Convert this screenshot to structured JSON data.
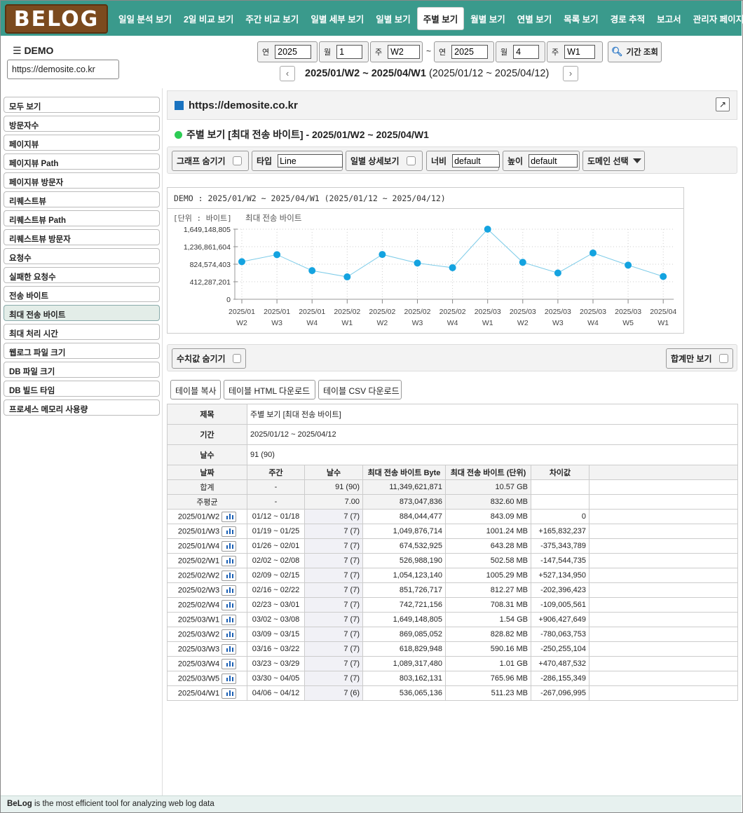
{
  "app": {
    "logo": "BELOG"
  },
  "nav": [
    "일일 분석 보기",
    "2일 비교 보기",
    "주간 비교 보기",
    "일별 세부 보기",
    "일별 보기",
    "주별 보기",
    "월별 보기",
    "연별 보기",
    "목록 보기",
    "경로 추적",
    "보고서",
    "관리자 페이지"
  ],
  "nav_active_index": 5,
  "header": {
    "menu_title": "☰ DEMO",
    "site_url": "https://demosite.co.kr"
  },
  "period": {
    "from_year_label": "연",
    "from_year": "2025",
    "from_month_label": "월",
    "from_month": "1",
    "from_week_label": "주",
    "from_week": "W2",
    "tilde": "~",
    "to_year_label": "연",
    "to_year": "2025",
    "to_month_label": "월",
    "to_month": "4",
    "to_week_label": "주",
    "to_week": "W1",
    "search_label": "기간 조회",
    "range_bold": "2025/01/W2 ~ 2025/04/W1",
    "range_dates": " (2025/01/12 ~ 2025/04/12)",
    "prev": "‹",
    "next": "›"
  },
  "sidebar": [
    "모두 보기",
    "방문자수",
    "페이지뷰",
    "페이지뷰 Path",
    "페이지뷰 방문자",
    "리퀘스트뷰",
    "리퀘스트뷰 Path",
    "리퀘스트뷰 방문자",
    "요청수",
    "실패한 요청수",
    "전송 바이트",
    "최대 전송 바이트",
    "최대 처리 시간",
    "웹로그 파일 크기",
    "DB 파일 크기",
    "DB 빌드 타임",
    "프로세스 메모리 사용량"
  ],
  "sidebar_active_index": 11,
  "main": {
    "site_title": "https://demosite.co.kr",
    "section_title": "주별 보기 [최대 전송 바이트] - 2025/01/W2 ~ 2025/04/W1",
    "toolbar": {
      "hide_graph": "그래프 숨기기",
      "type_label": "타입",
      "type_value": "Line",
      "daily_detail": "일별 상세보기",
      "width_label": "너비",
      "width_value": "default",
      "height_label": "높이",
      "height_value": "default",
      "domain_select": "도메인 선택"
    },
    "toolbar2": {
      "hide_values": "수치값 숨기기",
      "total_only": "합계만 보기"
    },
    "buttons": {
      "copy": "테이블 복사",
      "html": "테이블 HTML 다운로드",
      "csv": "테이블 CSV 다운로드"
    }
  },
  "chart_data": {
    "type": "line",
    "title": "DEMO : 2025/01/W2 ~ 2025/04/W1 (2025/01/12 ~ 2025/04/12)",
    "unit_label": "[단위 : 바이트]",
    "series_label": "최대 전송 바이트",
    "categories": [
      [
        "2025/01",
        "W2"
      ],
      [
        "2025/01",
        "W3"
      ],
      [
        "2025/01",
        "W4"
      ],
      [
        "2025/02",
        "W1"
      ],
      [
        "2025/02",
        "W2"
      ],
      [
        "2025/02",
        "W3"
      ],
      [
        "2025/02",
        "W4"
      ],
      [
        "2025/03",
        "W1"
      ],
      [
        "2025/03",
        "W2"
      ],
      [
        "2025/03",
        "W3"
      ],
      [
        "2025/03",
        "W4"
      ],
      [
        "2025/03",
        "W5"
      ],
      [
        "2025/04",
        "W1"
      ]
    ],
    "y_ticks": [
      "1,649,148,805",
      "1,236,861,604",
      "824,574,403",
      "412,287,201",
      "0"
    ],
    "ylim": [
      0,
      1649148805
    ],
    "series": [
      {
        "name": "최대 전송 바이트",
        "values": [
          884044477,
          1049876714,
          674532925,
          526988190,
          1054123140,
          851726717,
          742721156,
          1649148805,
          869085052,
          618829948,
          1089317480,
          803162131,
          536065136
        ],
        "color": "#14a3e0"
      }
    ],
    "grid": true
  },
  "table": {
    "info": [
      {
        "label": "제목",
        "value": "주별 보기 [최대 전송 바이트]"
      },
      {
        "label": "기간",
        "value": "2025/01/12 ~ 2025/04/12"
      },
      {
        "label": "날수",
        "value": "91 (90)"
      }
    ],
    "headers": [
      "날짜",
      "주간",
      "날수",
      "최대 전송 바이트 Byte",
      "최대 전송 바이트 (단위)",
      "차이값",
      ""
    ],
    "summary": [
      {
        "date": "합계",
        "week": "-",
        "days": "91 (90)",
        "bytes": "11,349,621,871",
        "unit": "10.57 GB",
        "diff": ""
      },
      {
        "date": "주평균",
        "week": "-",
        "days": "7.00",
        "bytes": "873,047,836",
        "unit": "832.60 MB",
        "diff": ""
      }
    ],
    "rows": [
      {
        "date": "2025/01/W2",
        "week": "01/12 ~ 01/18",
        "days": "7 (7)",
        "bytes": "884,044,477",
        "unit": "843.09 MB",
        "diff": "0"
      },
      {
        "date": "2025/01/W3",
        "week": "01/19 ~ 01/25",
        "days": "7 (7)",
        "bytes": "1,049,876,714",
        "unit": "1001.24 MB",
        "diff": "+165,832,237"
      },
      {
        "date": "2025/01/W4",
        "week": "01/26 ~ 02/01",
        "days": "7 (7)",
        "bytes": "674,532,925",
        "unit": "643.28 MB",
        "diff": "-375,343,789"
      },
      {
        "date": "2025/02/W1",
        "week": "02/02 ~ 02/08",
        "days": "7 (7)",
        "bytes": "526,988,190",
        "unit": "502.58 MB",
        "diff": "-147,544,735"
      },
      {
        "date": "2025/02/W2",
        "week": "02/09 ~ 02/15",
        "days": "7 (7)",
        "bytes": "1,054,123,140",
        "unit": "1005.29 MB",
        "diff": "+527,134,950"
      },
      {
        "date": "2025/02/W3",
        "week": "02/16 ~ 02/22",
        "days": "7 (7)",
        "bytes": "851,726,717",
        "unit": "812.27 MB",
        "diff": "-202,396,423"
      },
      {
        "date": "2025/02/W4",
        "week": "02/23 ~ 03/01",
        "days": "7 (7)",
        "bytes": "742,721,156",
        "unit": "708.31 MB",
        "diff": "-109,005,561"
      },
      {
        "date": "2025/03/W1",
        "week": "03/02 ~ 03/08",
        "days": "7 (7)",
        "bytes": "1,649,148,805",
        "unit": "1.54 GB",
        "diff": "+906,427,649"
      },
      {
        "date": "2025/03/W2",
        "week": "03/09 ~ 03/15",
        "days": "7 (7)",
        "bytes": "869,085,052",
        "unit": "828.82 MB",
        "diff": "-780,063,753"
      },
      {
        "date": "2025/03/W3",
        "week": "03/16 ~ 03/22",
        "days": "7 (7)",
        "bytes": "618,829,948",
        "unit": "590.16 MB",
        "diff": "-250,255,104"
      },
      {
        "date": "2025/03/W4",
        "week": "03/23 ~ 03/29",
        "days": "7 (7)",
        "bytes": "1,089,317,480",
        "unit": "1.01 GB",
        "diff": "+470,487,532"
      },
      {
        "date": "2025/03/W5",
        "week": "03/30 ~ 04/05",
        "days": "7 (7)",
        "bytes": "803,162,131",
        "unit": "765.96 MB",
        "diff": "-286,155,349"
      },
      {
        "date": "2025/04/W1",
        "week": "04/06 ~ 04/12",
        "days": "7 (6)",
        "bytes": "536,065,136",
        "unit": "511.23 MB",
        "diff": "-267,096,995"
      }
    ]
  },
  "footer": {
    "brand": "BeLog",
    "text": " is the most efficient tool for analyzing web log data"
  }
}
